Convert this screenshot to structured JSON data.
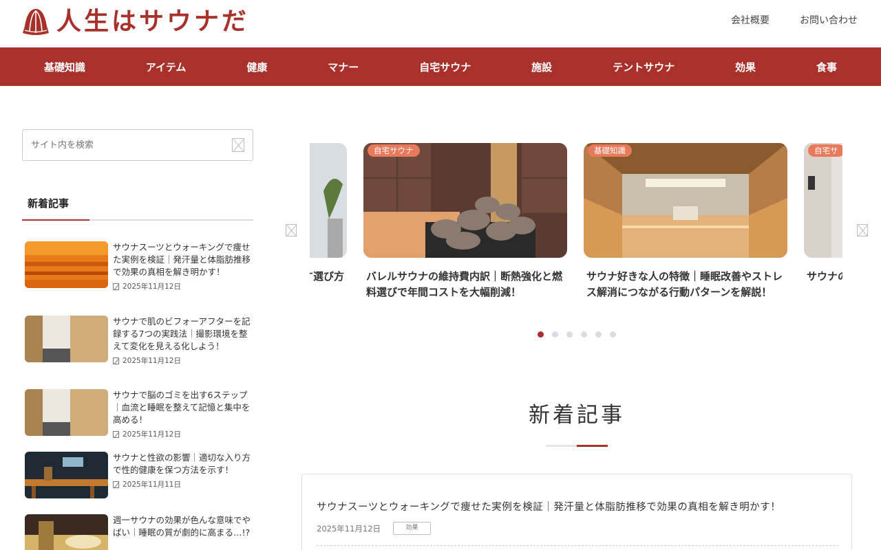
{
  "site": {
    "logo_text": "人生はサウナだ",
    "brand_color": "#a8322b"
  },
  "header_links": [
    {
      "label": "会社概要"
    },
    {
      "label": "お問い合わせ"
    }
  ],
  "nav": [
    {
      "label": "基礎知識"
    },
    {
      "label": "アイテム"
    },
    {
      "label": "健康"
    },
    {
      "label": "マナー"
    },
    {
      "label": "自宅サウナ"
    },
    {
      "label": "施設"
    },
    {
      "label": "テントサウナ"
    },
    {
      "label": "効果"
    },
    {
      "label": "食事"
    }
  ],
  "sidebar": {
    "search_placeholder": "サイト内を検索",
    "recent_heading": "新着記事",
    "recent": [
      {
        "title": "サウナスーツとウォーキングで痩せた実例を検証｜発汗量と体脂肪推移で効果の真相を解き明かす！",
        "date": "2025年11月12日"
      },
      {
        "title": "サウナで肌のビフォーアフターを記録する7つの実践法｜撮影環境を整えて変化を見える化しよう！",
        "date": "2025年11月12日"
      },
      {
        "title": "サウナで脳のゴミを出す6ステップ｜血流と睡眠を整えて記憶と集中を高める！",
        "date": "2025年11月12日"
      },
      {
        "title": "サウナと性欲の影響｜適切な入り方で性的健康を保つ方法を示す！",
        "date": "2025年11月11日"
      },
      {
        "title": "週一サウナの効果が色んな意味でやばい｜睡眠の質が劇的に高まる…!?",
        "date": ""
      }
    ]
  },
  "carousel": {
    "cards": [
      {
        "badge": "",
        "title": "導入す選び方"
      },
      {
        "badge": "自宅サウナ",
        "title": "バレルサウナの維持費内訳｜断熱強化と燃料選びで年間コストを大幅削減！"
      },
      {
        "badge": "基礎知識",
        "title": "サウナ好きな人の特徴｜睡眠改善やストレス解消につながる行動パターンを解説！"
      },
      {
        "badge": "自宅サ",
        "title": "サウナの全なサ"
      }
    ],
    "dots": 6,
    "active_dot": 0
  },
  "main": {
    "section_title": "新着記事",
    "articles": [
      {
        "title": "サウナスーツとウォーキングで痩せた実例を検証｜発汗量と体脂肪推移で効果の真相を解き明かす！",
        "date": "2025年11月12日",
        "tag": "効果"
      }
    ]
  }
}
